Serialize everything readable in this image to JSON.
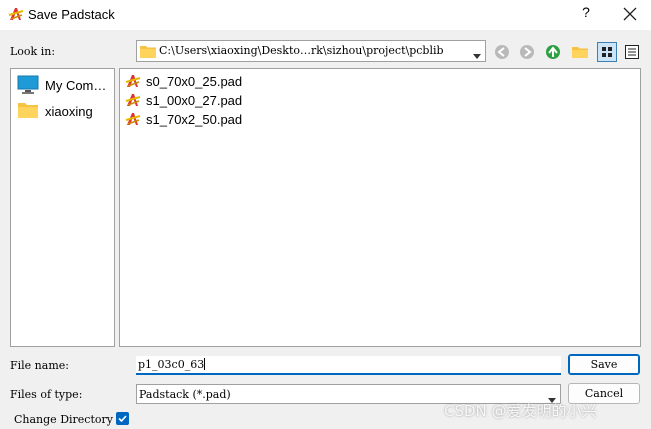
{
  "window": {
    "title": "Save Padstack",
    "help_label": "?"
  },
  "look_in": {
    "label": "Look in:",
    "path": "C:\\Users\\xiaoxing\\Deskto…rk\\sizhou\\project\\pcblib"
  },
  "toolbar": {
    "icons": [
      "back-icon",
      "forward-icon",
      "parent-folder-icon",
      "new-folder-icon",
      "list-view-icon",
      "detail-view-icon"
    ]
  },
  "sidebar": {
    "items": [
      {
        "label": "My Com…",
        "icon": "computer-icon"
      },
      {
        "label": "xiaoxing",
        "icon": "folder-icon"
      }
    ]
  },
  "files": [
    {
      "name": "s0_70x0_25.pad"
    },
    {
      "name": "s1_00x0_27.pad"
    },
    {
      "name": "s1_70x2_50.pad"
    }
  ],
  "file_name": {
    "label": "File name:",
    "value": "p1_03c0_63"
  },
  "file_type": {
    "label": "Files of type:",
    "value": "Padstack (*.pad)"
  },
  "buttons": {
    "save": "Save",
    "cancel": "Cancel"
  },
  "change_directory": {
    "label": "Change Directory",
    "checked": true
  },
  "watermark": "CSDN @爱发明的小兴",
  "colors": {
    "accent": "#0067c0",
    "window_bg": "#f0f0f0"
  }
}
